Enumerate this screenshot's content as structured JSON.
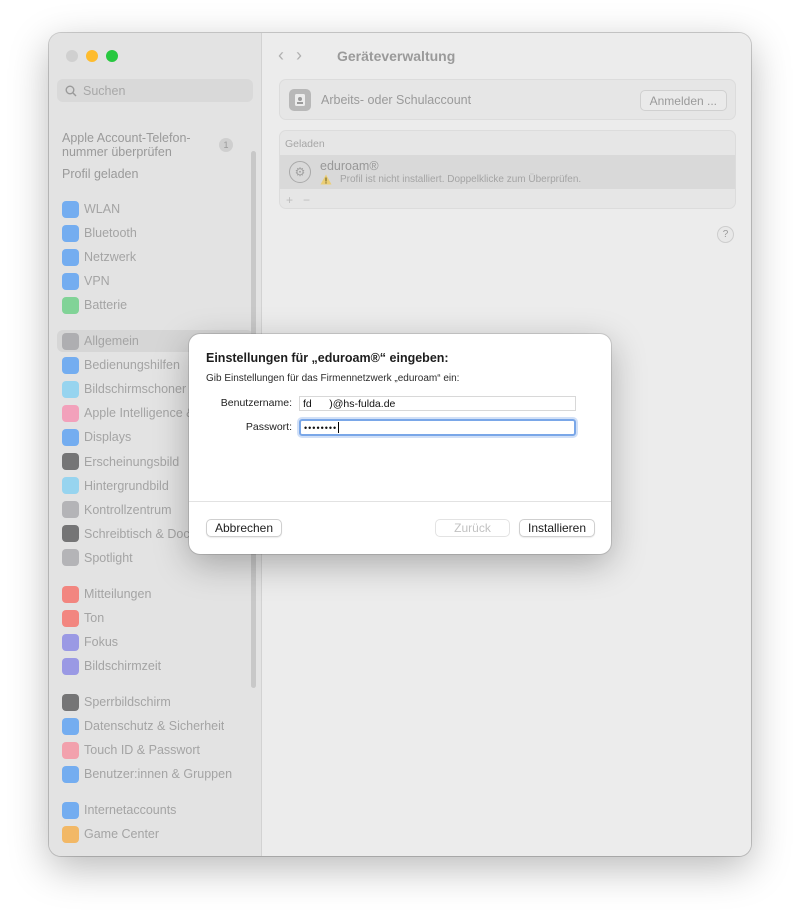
{
  "window": {
    "traffic_lights": {
      "close": "#d0d0d0",
      "minimize": "#febc2e",
      "zoom": "#28c840"
    }
  },
  "sidebar": {
    "search_placeholder": "Suchen",
    "apple_account_line1": "Apple Account-Telefon-",
    "apple_account_line2": "nummer überprüfen",
    "apple_account_badge": "1",
    "profile_loaded": "Profil geladen",
    "groups": [
      [
        {
          "label": "WLAN",
          "icon": "wifi-icon",
          "color": "#1a82fb"
        },
        {
          "label": "Bluetooth",
          "icon": "bluetooth-icon",
          "color": "#1a82fb"
        },
        {
          "label": "Netzwerk",
          "icon": "globe-icon",
          "color": "#1a82fb"
        },
        {
          "label": "VPN",
          "icon": "vpn-icon",
          "color": "#1a82fb"
        },
        {
          "label": "Batterie",
          "icon": "battery-icon",
          "color": "#32c759"
        }
      ],
      [
        {
          "label": "Allgemein",
          "icon": "gear-icon",
          "color": "#8e8e93",
          "selected": true
        },
        {
          "label": "Bedienungshilfen",
          "icon": "accessibility-icon",
          "color": "#1a82fb"
        },
        {
          "label": "Bildschirmschoner",
          "icon": "screensaver-icon",
          "color": "#5ac8fa"
        },
        {
          "label": "Apple Intelligence & Siri",
          "icon": "siri-icon",
          "color": "#ff6b9a"
        },
        {
          "label": "Displays",
          "icon": "sun-icon",
          "color": "#1a82fb"
        },
        {
          "label": "Erscheinungsbild",
          "icon": "appearance-icon",
          "color": "#1c1c1e"
        },
        {
          "label": "Hintergrundbild",
          "icon": "wallpaper-icon",
          "color": "#5ac8fa"
        },
        {
          "label": "Kontrollzentrum",
          "icon": "controlcenter-icon",
          "color": "#8e8e93"
        },
        {
          "label": "Schreibtisch & Dock",
          "icon": "dock-icon",
          "color": "#1c1c1e"
        },
        {
          "label": "Spotlight",
          "icon": "spotlight-icon",
          "color": "#8e8e93"
        }
      ],
      [
        {
          "label": "Mitteilungen",
          "icon": "bell-icon",
          "color": "#ff3b30"
        },
        {
          "label": "Ton",
          "icon": "speaker-icon",
          "color": "#ff3b30"
        },
        {
          "label": "Fokus",
          "icon": "moon-icon",
          "color": "#5e5ce6"
        },
        {
          "label": "Bildschirmzeit",
          "icon": "hourglass-icon",
          "color": "#5e5ce6"
        }
      ],
      [
        {
          "label": "Sperrbildschirm",
          "icon": "lock-icon",
          "color": "#1c1c1e"
        },
        {
          "label": "Datenschutz & Sicherheit",
          "icon": "hand-icon",
          "color": "#1a82fb"
        },
        {
          "label": "Touch ID & Passwort",
          "icon": "fingerprint-icon",
          "color": "#ff6b81"
        },
        {
          "label": "Benutzer:innen & Gruppen",
          "icon": "users-icon",
          "color": "#1a82fb"
        }
      ],
      [
        {
          "label": "Internetaccounts",
          "icon": "at-icon",
          "color": "#1a82fb"
        },
        {
          "label": "Game Center",
          "icon": "gamecenter-icon",
          "color": "#ff9500"
        }
      ]
    ]
  },
  "main": {
    "title": "Geräteverwaltung",
    "account": {
      "label": "Arbeits- oder Schulaccount",
      "button": "Anmelden ..."
    },
    "loaded": {
      "section_label": "Geladen",
      "profile_name": "eduroam®",
      "profile_warning": "Profil ist nicht installiert. Doppelklicke zum Überprüfen."
    },
    "add_symbol": "+",
    "remove_symbol": "−",
    "help_symbol": "?"
  },
  "dialog": {
    "title": "Einstellungen für „eduroam®“ eingeben:",
    "subtitle": "Gib Einstellungen für das Firmennetzwerk „eduroam“ ein:",
    "username_label": "Benutzername:",
    "username_value": "fd      )@hs-fulda.de",
    "password_label": "Passwort:",
    "password_value": "••••••••",
    "cancel": "Abbrechen",
    "back": "Zurück",
    "install": "Installieren"
  }
}
